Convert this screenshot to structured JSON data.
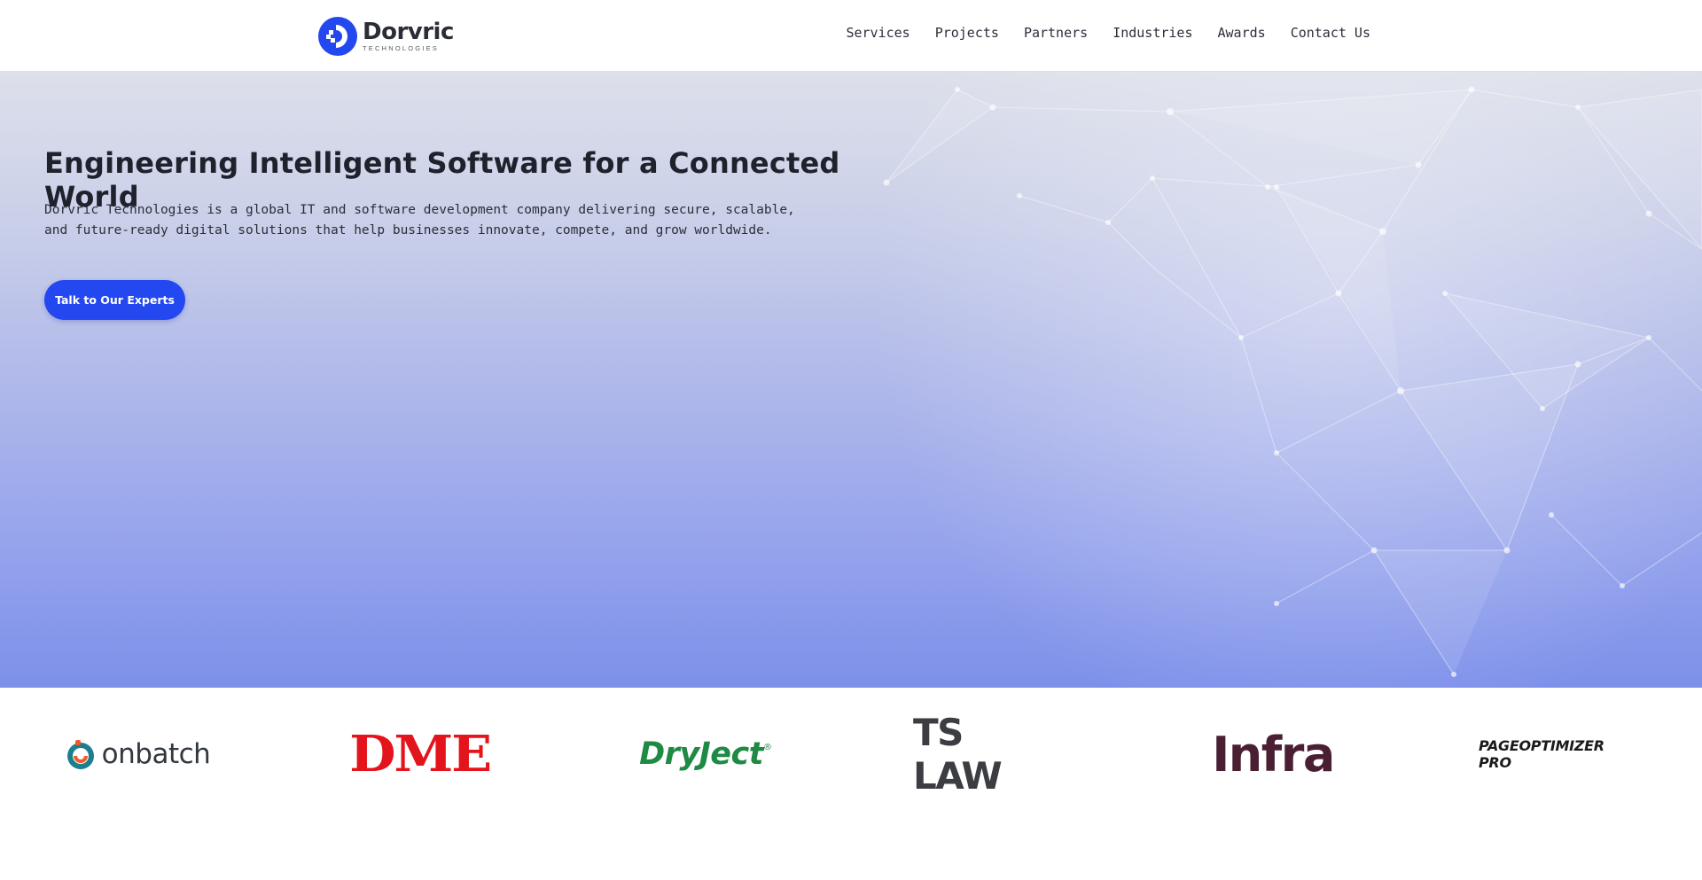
{
  "header": {
    "logo": {
      "name": "Dorvric",
      "subtitle": "TECHNOLOGIES",
      "icon": "dorvric-logo-mark",
      "color": "#2448f0"
    },
    "nav": [
      {
        "label": "Services"
      },
      {
        "label": "Projects"
      },
      {
        "label": "Partners"
      },
      {
        "label": "Industries"
      },
      {
        "label": "Awards"
      },
      {
        "label": "Contact Us"
      }
    ]
  },
  "hero": {
    "title": "Engineering Intelligent Software for a Connected World",
    "description": "Dorvric Technologies is a global IT and software development company delivering secure, scalable, and future-ready digital solutions that help businesses innovate, compete, and grow worldwide.",
    "cta_label": "Talk to Our Experts",
    "background_icon": "network-mesh-graphic",
    "accent": "#2448f0"
  },
  "partners": [
    {
      "name": "onbatch",
      "icon": "onbatch-swirl-icon",
      "color": "#333840"
    },
    {
      "name": "DME",
      "color": "#e3141b"
    },
    {
      "name": "DryJect",
      "registered": "®",
      "color": "#1f8a44"
    },
    {
      "name": "TS LAW",
      "color": "#3b3d42"
    },
    {
      "name": "Infra",
      "color": "#4a1f33"
    },
    {
      "name": "PAGEOPTIMIZER PRO",
      "color": "#1a1a1a"
    }
  ]
}
